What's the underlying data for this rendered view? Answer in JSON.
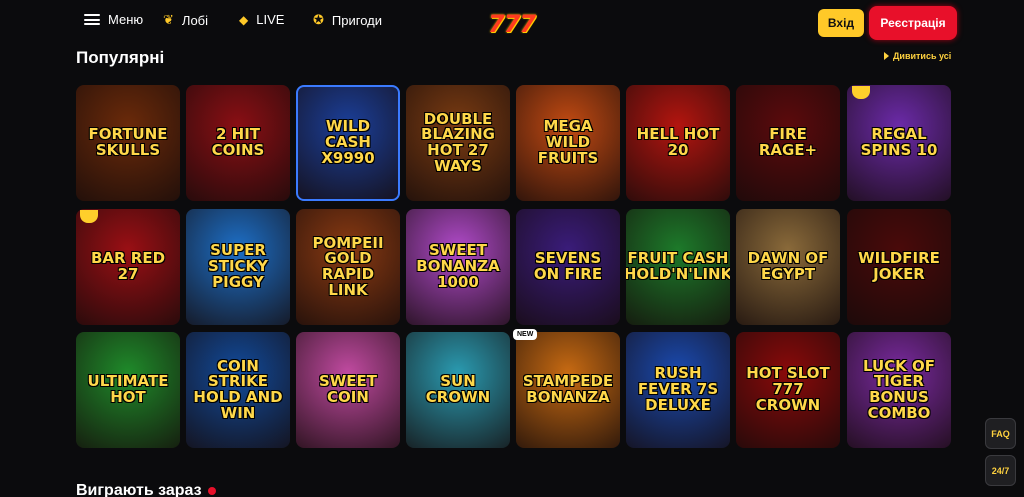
{
  "nav": {
    "menu_label": "Меню",
    "lobby_label": "Лобі",
    "live_label": "LIVE",
    "adventures_label": "Пригоди"
  },
  "logo": "777",
  "buttons": {
    "login": "Вхід",
    "register": "Реєстрація"
  },
  "popular": {
    "title": "Популярні",
    "see_all": "Дивитись усі",
    "games": [
      {
        "title": "Fortune Skulls",
        "color": "#6b2a0a"
      },
      {
        "title": "2 Hit Coins",
        "color": "#8a0f14"
      },
      {
        "title": "Wild Cash X9990",
        "color": "#1b3f9a"
      },
      {
        "title": "Double Blazing Hot 27 Ways",
        "color": "#7a3b12"
      },
      {
        "title": "Mega Wild Fruits",
        "color": "#c24a12"
      },
      {
        "title": "Hell Hot 20",
        "color": "#b3150f"
      },
      {
        "title": "Fire Rage+",
        "color": "#5c0a0c"
      },
      {
        "title": "Regal Spins 10",
        "color": "#6b2aa8"
      },
      {
        "title": "Bar Red 27",
        "color": "#9a0f14"
      },
      {
        "title": "Super Sticky Piggy",
        "color": "#1d6fc7"
      },
      {
        "title": "Pompeii Gold Rapid Link",
        "color": "#8a3a12"
      },
      {
        "title": "Sweet Bonanza 1000",
        "color": "#b04ac9"
      },
      {
        "title": "Sevens on Fire",
        "color": "#3a1c7a"
      },
      {
        "title": "Fruit Cash Hold'n'Link",
        "color": "#1d7a2a"
      },
      {
        "title": "Dawn of Egypt",
        "color": "#8a6a3a"
      },
      {
        "title": "Wildfire Joker",
        "color": "#4a0a0a"
      },
      {
        "title": "Ultimate Hot",
        "color": "#1f8a2a"
      },
      {
        "title": "Coin Strike Hold and Win",
        "color": "#124a9a"
      },
      {
        "title": "Sweet Coin",
        "color": "#c04aa0"
      },
      {
        "title": "Sun Crown",
        "color": "#2a9ab0"
      },
      {
        "title": "Stampede Bonanza",
        "color": "#c76a12"
      },
      {
        "title": "Rush Fever 7s Deluxe",
        "color": "#1a4ab0"
      },
      {
        "title": "Hot Slot 777 Crown",
        "color": "#8a0a0a"
      },
      {
        "title": "Luck of Tiger Bonus Combo",
        "color": "#7a2aa0"
      }
    ],
    "new_badge": "NEW"
  },
  "winning_now": {
    "title": "Виграють зараз"
  },
  "side": {
    "faq": "FAQ",
    "support": "24/7"
  }
}
